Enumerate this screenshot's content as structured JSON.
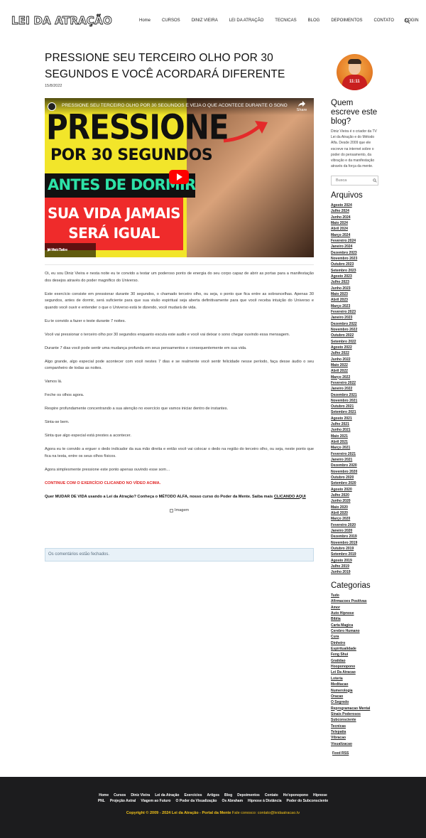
{
  "header": {
    "logo": "LEI DA ATRAÇÃO",
    "nav": [
      "Home",
      "CURSOS",
      "DINIZ VIEIRA",
      "LEI DA ATRAÇÃO",
      "TECNICAS",
      "BLOG",
      "DEPOIMENTOS",
      "CONTATO",
      "LOGIN"
    ]
  },
  "post": {
    "title": "PRESSIONE SEU TERCEIRO OLHO POR 30 SEGUNDOS E VOCÊ ACORDARÁ DIFERENTE",
    "date": "15/8/2022",
    "video": {
      "title": "PRESSIONE SEU TERCEIRO OLHO POR 30 SEGUNDOS E VEJA O QUE ACONTECE DURANTE O SONO | Ouça...",
      "share": "Share",
      "line1": "PRESSIONE",
      "line2": "POR 30 SEGUNDOS",
      "line3": "ANTES DE DORMIR",
      "line4": "SUA VIDA JAMAIS",
      "line5": "SERÁ IGUAL",
      "watch_on": "Watch on",
      "youtube": "▶ YouTube"
    },
    "paragraphs": [
      " Oi, eu sou Diniz Vieira e nesta noite eu te convido a testar um poderoso ponto de energia do seu corpo capaz de abrir as portas para a manifestação dos desejos através do poder magnífico do Universo.",
      "Este exercício consiste em pressionar durante 30 segundos, o chamado terceiro olho, ou seja, o ponto que fica entre as sobrancelhas. Apenas 30 segundos, antes de dormir, será suficiente para que sua visão espiritual seja aberta definitivamente para que você receba intuição do Universo e quando você ouvir e entender o que o Universo está te dizendo, você mudará de vida.",
      "Eu te convido a fazer o teste durante 7 noites.",
      "Você vai pressionar o terceiro olho por 30 segundos enquanto escuta este audio e você vai deixar o sono chegar ouvindo essa mensagem.",
      "Durante 7 dias você pode sentir uma mudança profunda em seus pensamentos e consequentemente em sua vida.",
      "Algo grande, algo especial pode acontecer com você nestes 7 dias e se realmente você sentir felicidade nesse período, faça desse áudio o seu companheiro de todas as noites.",
      "Vamos lá.",
      "Feche os olhos agora.",
      "Respire profundamente concentrando a sua atenção no exercício que vamos iniciar dentro de instantes.",
      "Sinta-se bem.",
      "Sinta que algo especial está prestes a acontecer.",
      "Agora eu te convido a erguer o dedo indicador da sua mão direita e então você vai colocar o dedo na região do terceiro olho, ou seja, neste ponto que fica na testa, entre os seus olhos físicos.",
      "Agora simplesmente pressione este ponto apenas ouvindo esse som…"
    ],
    "cta_red": "CONTINUE COM O EXERCÍCIO CLICANDO NO VÍDEO ACIMA.",
    "cta_bold": "Quer MUDAR DE VIDA usando a Lei da Atração? Conheça o MÉTODO ALFA, nosso curso do Poder da Mente. Saiba mais ",
    "cta_link": "CLICANDO AQUI",
    "image_alt": "Imagem",
    "comments_closed": "Os comentários estão fechados."
  },
  "sidebar": {
    "about_heading": "Quem escreve este blog?",
    "about_text": "Diniz Vieira é o criador da TV Lei da Atração e do Método Alfa. Desde 2009 que ele escreve na internet sobre o poder do pensamento, da vibração e da manifestação através da força da mente.",
    "avatar_text": "11:11",
    "search_placeholder": "Busca",
    "archives_heading": "Arquivos",
    "archives": [
      "Agosto 2024",
      "Julho 2024",
      "Junho 2024",
      "Maio 2024",
      "Abril 2024",
      "Março 2024",
      "Fevereiro 2024",
      "Janeiro 2024",
      "Dezembro 2023",
      "Novembro 2023",
      "Outubro 2023",
      "Setembro 2023",
      "Agosto 2023",
      "Julho 2023",
      "Junho 2023",
      "Maio 2023",
      "Abril 2023",
      "Março 2023",
      "Fevereiro 2023",
      "Janeiro 2023",
      "Dezembro 2022",
      "Novembro 2022",
      "Outubro 2022",
      "Setembro 2022",
      "Agosto 2022",
      "Julho 2022",
      "Junho 2022",
      "Maio 2022",
      "Abril 2022",
      "Março 2022",
      "Fevereiro 2022",
      "Janeiro 2022",
      "Dezembro 2021",
      "Novembro 2021",
      "Outubro 2021",
      "Setembro 2021",
      "Agosto 2021",
      "Julho 2021",
      "Junho 2021",
      "Maio 2021",
      "Abril 2021",
      "Março 2021",
      "Fevereiro 2021",
      "Janeiro 2021",
      "Dezembro 2020",
      "Novembro 2020",
      "Outubro 2020",
      "Setembro 2020",
      "Agosto 2020",
      "Julho 2020",
      "Junho 2020",
      "Maio 2020",
      "Abril 2020",
      "Março 2020",
      "Fevereiro 2020",
      "Janeiro 2020",
      "Dezembro 2019",
      "Novembro 2019",
      "Outubro 2019",
      "Setembro 2019",
      "Agosto 2019",
      "Julho 2019",
      "Junho 2019"
    ],
    "categories_heading": "Categorias",
    "categories": [
      "Tudo",
      "Afirmacoes Positivas",
      "Amor",
      "Auto Hipnose",
      "Bíblia",
      "Carta Magica",
      "Cerebro Humano",
      "Cura",
      "Dinheiro",
      "Espiritualidade",
      "Feng Shui",
      "Gratidao",
      "Hooponopono",
      "Lei Da Atracao",
      "Loteria",
      "Meditacao",
      "Numerologia",
      "Oracao",
      "O Segredo",
      "Reprogramacao Mental",
      "Sinais Poderosos",
      "Subconsciente",
      "Tecnicas",
      "Telepatia",
      "Vibracao",
      "Visualizacao"
    ],
    "feed": "Feed RSS"
  },
  "footer": {
    "links_row1": [
      "Home",
      "Cursos",
      "Diniz Vieira",
      "Lei da Atração",
      "Exercícios",
      "Artigos",
      "Blog",
      "Depoimentos",
      "Contato",
      "Ho'oponopono",
      "Hipnose"
    ],
    "links_row2": [
      "PNL",
      "Projeção Astral",
      "Viagem ao Futuro",
      "O Poder da Visualização",
      "Os Abraham",
      "Hipnose à Distância",
      "Poder do Subconsciente"
    ],
    "copyright": "Copyright © 2009 - 2024 Lei da Atração - Portal da Mente",
    "contact": " Fale conosco: contato@leidaatracao.tv"
  },
  "colors": {
    "accent_red": "#e02424",
    "footer_bg": "#1c1c1e",
    "footer_gold": "#f3c319",
    "notice_bg": "#e8f1f8"
  }
}
